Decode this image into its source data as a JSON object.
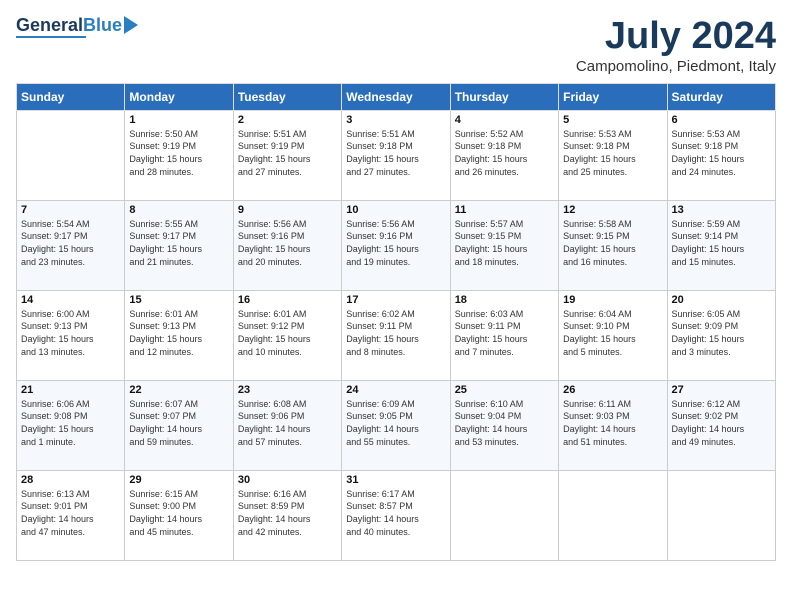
{
  "logo": {
    "general": "General",
    "blue": "Blue"
  },
  "title": "July 2024",
  "location": "Campomolino, Piedmont, Italy",
  "days_of_week": [
    "Sunday",
    "Monday",
    "Tuesday",
    "Wednesday",
    "Thursday",
    "Friday",
    "Saturday"
  ],
  "weeks": [
    [
      {
        "day": null,
        "info": null
      },
      {
        "day": "1",
        "info": "Sunrise: 5:50 AM\nSunset: 9:19 PM\nDaylight: 15 hours\nand 28 minutes."
      },
      {
        "day": "2",
        "info": "Sunrise: 5:51 AM\nSunset: 9:19 PM\nDaylight: 15 hours\nand 27 minutes."
      },
      {
        "day": "3",
        "info": "Sunrise: 5:51 AM\nSunset: 9:18 PM\nDaylight: 15 hours\nand 27 minutes."
      },
      {
        "day": "4",
        "info": "Sunrise: 5:52 AM\nSunset: 9:18 PM\nDaylight: 15 hours\nand 26 minutes."
      },
      {
        "day": "5",
        "info": "Sunrise: 5:53 AM\nSunset: 9:18 PM\nDaylight: 15 hours\nand 25 minutes."
      },
      {
        "day": "6",
        "info": "Sunrise: 5:53 AM\nSunset: 9:18 PM\nDaylight: 15 hours\nand 24 minutes."
      }
    ],
    [
      {
        "day": "7",
        "info": "Sunrise: 5:54 AM\nSunset: 9:17 PM\nDaylight: 15 hours\nand 23 minutes."
      },
      {
        "day": "8",
        "info": "Sunrise: 5:55 AM\nSunset: 9:17 PM\nDaylight: 15 hours\nand 21 minutes."
      },
      {
        "day": "9",
        "info": "Sunrise: 5:56 AM\nSunset: 9:16 PM\nDaylight: 15 hours\nand 20 minutes."
      },
      {
        "day": "10",
        "info": "Sunrise: 5:56 AM\nSunset: 9:16 PM\nDaylight: 15 hours\nand 19 minutes."
      },
      {
        "day": "11",
        "info": "Sunrise: 5:57 AM\nSunset: 9:15 PM\nDaylight: 15 hours\nand 18 minutes."
      },
      {
        "day": "12",
        "info": "Sunrise: 5:58 AM\nSunset: 9:15 PM\nDaylight: 15 hours\nand 16 minutes."
      },
      {
        "day": "13",
        "info": "Sunrise: 5:59 AM\nSunset: 9:14 PM\nDaylight: 15 hours\nand 15 minutes."
      }
    ],
    [
      {
        "day": "14",
        "info": "Sunrise: 6:00 AM\nSunset: 9:13 PM\nDaylight: 15 hours\nand 13 minutes."
      },
      {
        "day": "15",
        "info": "Sunrise: 6:01 AM\nSunset: 9:13 PM\nDaylight: 15 hours\nand 12 minutes."
      },
      {
        "day": "16",
        "info": "Sunrise: 6:01 AM\nSunset: 9:12 PM\nDaylight: 15 hours\nand 10 minutes."
      },
      {
        "day": "17",
        "info": "Sunrise: 6:02 AM\nSunset: 9:11 PM\nDaylight: 15 hours\nand 8 minutes."
      },
      {
        "day": "18",
        "info": "Sunrise: 6:03 AM\nSunset: 9:11 PM\nDaylight: 15 hours\nand 7 minutes."
      },
      {
        "day": "19",
        "info": "Sunrise: 6:04 AM\nSunset: 9:10 PM\nDaylight: 15 hours\nand 5 minutes."
      },
      {
        "day": "20",
        "info": "Sunrise: 6:05 AM\nSunset: 9:09 PM\nDaylight: 15 hours\nand 3 minutes."
      }
    ],
    [
      {
        "day": "21",
        "info": "Sunrise: 6:06 AM\nSunset: 9:08 PM\nDaylight: 15 hours\nand 1 minute."
      },
      {
        "day": "22",
        "info": "Sunrise: 6:07 AM\nSunset: 9:07 PM\nDaylight: 14 hours\nand 59 minutes."
      },
      {
        "day": "23",
        "info": "Sunrise: 6:08 AM\nSunset: 9:06 PM\nDaylight: 14 hours\nand 57 minutes."
      },
      {
        "day": "24",
        "info": "Sunrise: 6:09 AM\nSunset: 9:05 PM\nDaylight: 14 hours\nand 55 minutes."
      },
      {
        "day": "25",
        "info": "Sunrise: 6:10 AM\nSunset: 9:04 PM\nDaylight: 14 hours\nand 53 minutes."
      },
      {
        "day": "26",
        "info": "Sunrise: 6:11 AM\nSunset: 9:03 PM\nDaylight: 14 hours\nand 51 minutes."
      },
      {
        "day": "27",
        "info": "Sunrise: 6:12 AM\nSunset: 9:02 PM\nDaylight: 14 hours\nand 49 minutes."
      }
    ],
    [
      {
        "day": "28",
        "info": "Sunrise: 6:13 AM\nSunset: 9:01 PM\nDaylight: 14 hours\nand 47 minutes."
      },
      {
        "day": "29",
        "info": "Sunrise: 6:15 AM\nSunset: 9:00 PM\nDaylight: 14 hours\nand 45 minutes."
      },
      {
        "day": "30",
        "info": "Sunrise: 6:16 AM\nSunset: 8:59 PM\nDaylight: 14 hours\nand 42 minutes."
      },
      {
        "day": "31",
        "info": "Sunrise: 6:17 AM\nSunset: 8:57 PM\nDaylight: 14 hours\nand 40 minutes."
      },
      {
        "day": null,
        "info": null
      },
      {
        "day": null,
        "info": null
      },
      {
        "day": null,
        "info": null
      }
    ]
  ]
}
